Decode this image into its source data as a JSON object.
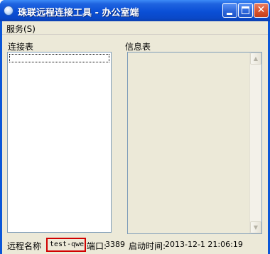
{
  "window": {
    "title": "珠联远程连接工具 - 办公室端"
  },
  "menu": {
    "items": [
      {
        "label": "服务(S)"
      }
    ]
  },
  "panels": {
    "connection_list_label": "连接表",
    "info_label": "信息表"
  },
  "status": {
    "remote_name_label": "远程名称",
    "remote_name_value": "test-qwe",
    "port_label": "端口:",
    "port_value": "3389",
    "start_time_label": "启动时间:",
    "start_time_value": "2013-12-1 21:06:19"
  },
  "icons": {
    "app": "app-globe-icon",
    "minimize": "minimize-icon",
    "maximize": "maximize-icon",
    "close": "close-icon",
    "scroll_up": "scroll-up-arrow-icon",
    "scroll_down": "scroll-down-arrow-icon"
  },
  "colors": {
    "titlebar": "#0a4fd6",
    "client_bg": "#ece9d8",
    "highlight_border": "#d10000",
    "close_button": "#d9542e"
  }
}
